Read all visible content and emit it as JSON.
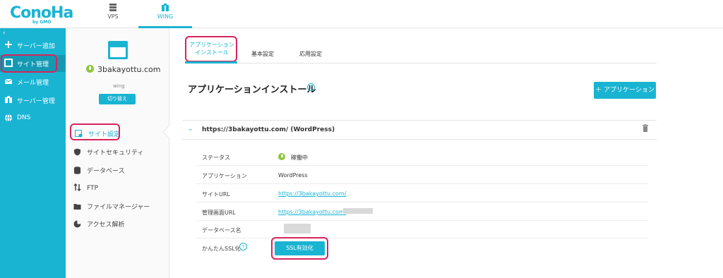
{
  "brand": {
    "logo": "ConoHa",
    "logo_sub": "by GMO"
  },
  "topnav": [
    {
      "label": "VPS"
    },
    {
      "label": "WING"
    }
  ],
  "sidebar": {
    "collapse": "‹",
    "items": [
      {
        "label": "サーバー追加",
        "icon": "plus-icon"
      },
      {
        "label": "サイト管理",
        "icon": "site-icon"
      },
      {
        "label": "メール管理",
        "icon": "mail-icon"
      },
      {
        "label": "サーバー管理",
        "icon": "server-icon"
      },
      {
        "label": "DNS",
        "icon": "globe-icon"
      }
    ]
  },
  "site_panel": {
    "domain": "3bakayottu.com",
    "plan": "wing",
    "switch_label": "切り替え",
    "items": [
      {
        "label": "サイト設定",
        "icon": "settings-icon"
      },
      {
        "label": "サイトセキュリティ",
        "icon": "shield-icon"
      },
      {
        "label": "データベース",
        "icon": "database-icon"
      },
      {
        "label": "FTP",
        "icon": "transfer-icon"
      },
      {
        "label": "ファイルマネージャー",
        "icon": "folder-icon"
      },
      {
        "label": "アクセス解析",
        "icon": "pie-chart-icon"
      }
    ]
  },
  "tabs": {
    "app_line1": "アプリケーション",
    "app_line2": "インストール",
    "basic": "基本設定",
    "advanced": "応用設定"
  },
  "main": {
    "title": "アプリケーションインストール",
    "help": "?",
    "add_button": "＋ アプリケーション",
    "card_url": "https://3bakayottu.com/ (WordPress)",
    "rows": [
      {
        "key": "ステータス",
        "value": "稼働中"
      },
      {
        "key": "アプリケーション",
        "value": "WordPress"
      },
      {
        "key": "サイトURL",
        "value": "https://3bakayottu.com/"
      },
      {
        "key": "管理画面URL",
        "value": "https://3bakayottu.com/"
      },
      {
        "key": "データベース名",
        "value": ""
      },
      {
        "key": "かんたんSSL化",
        "value": ""
      }
    ],
    "ssl_button": "SSL有効化"
  },
  "colors": {
    "accent": "#19b4d2",
    "highlight": "#d8245c",
    "status": "#8cc63f"
  }
}
